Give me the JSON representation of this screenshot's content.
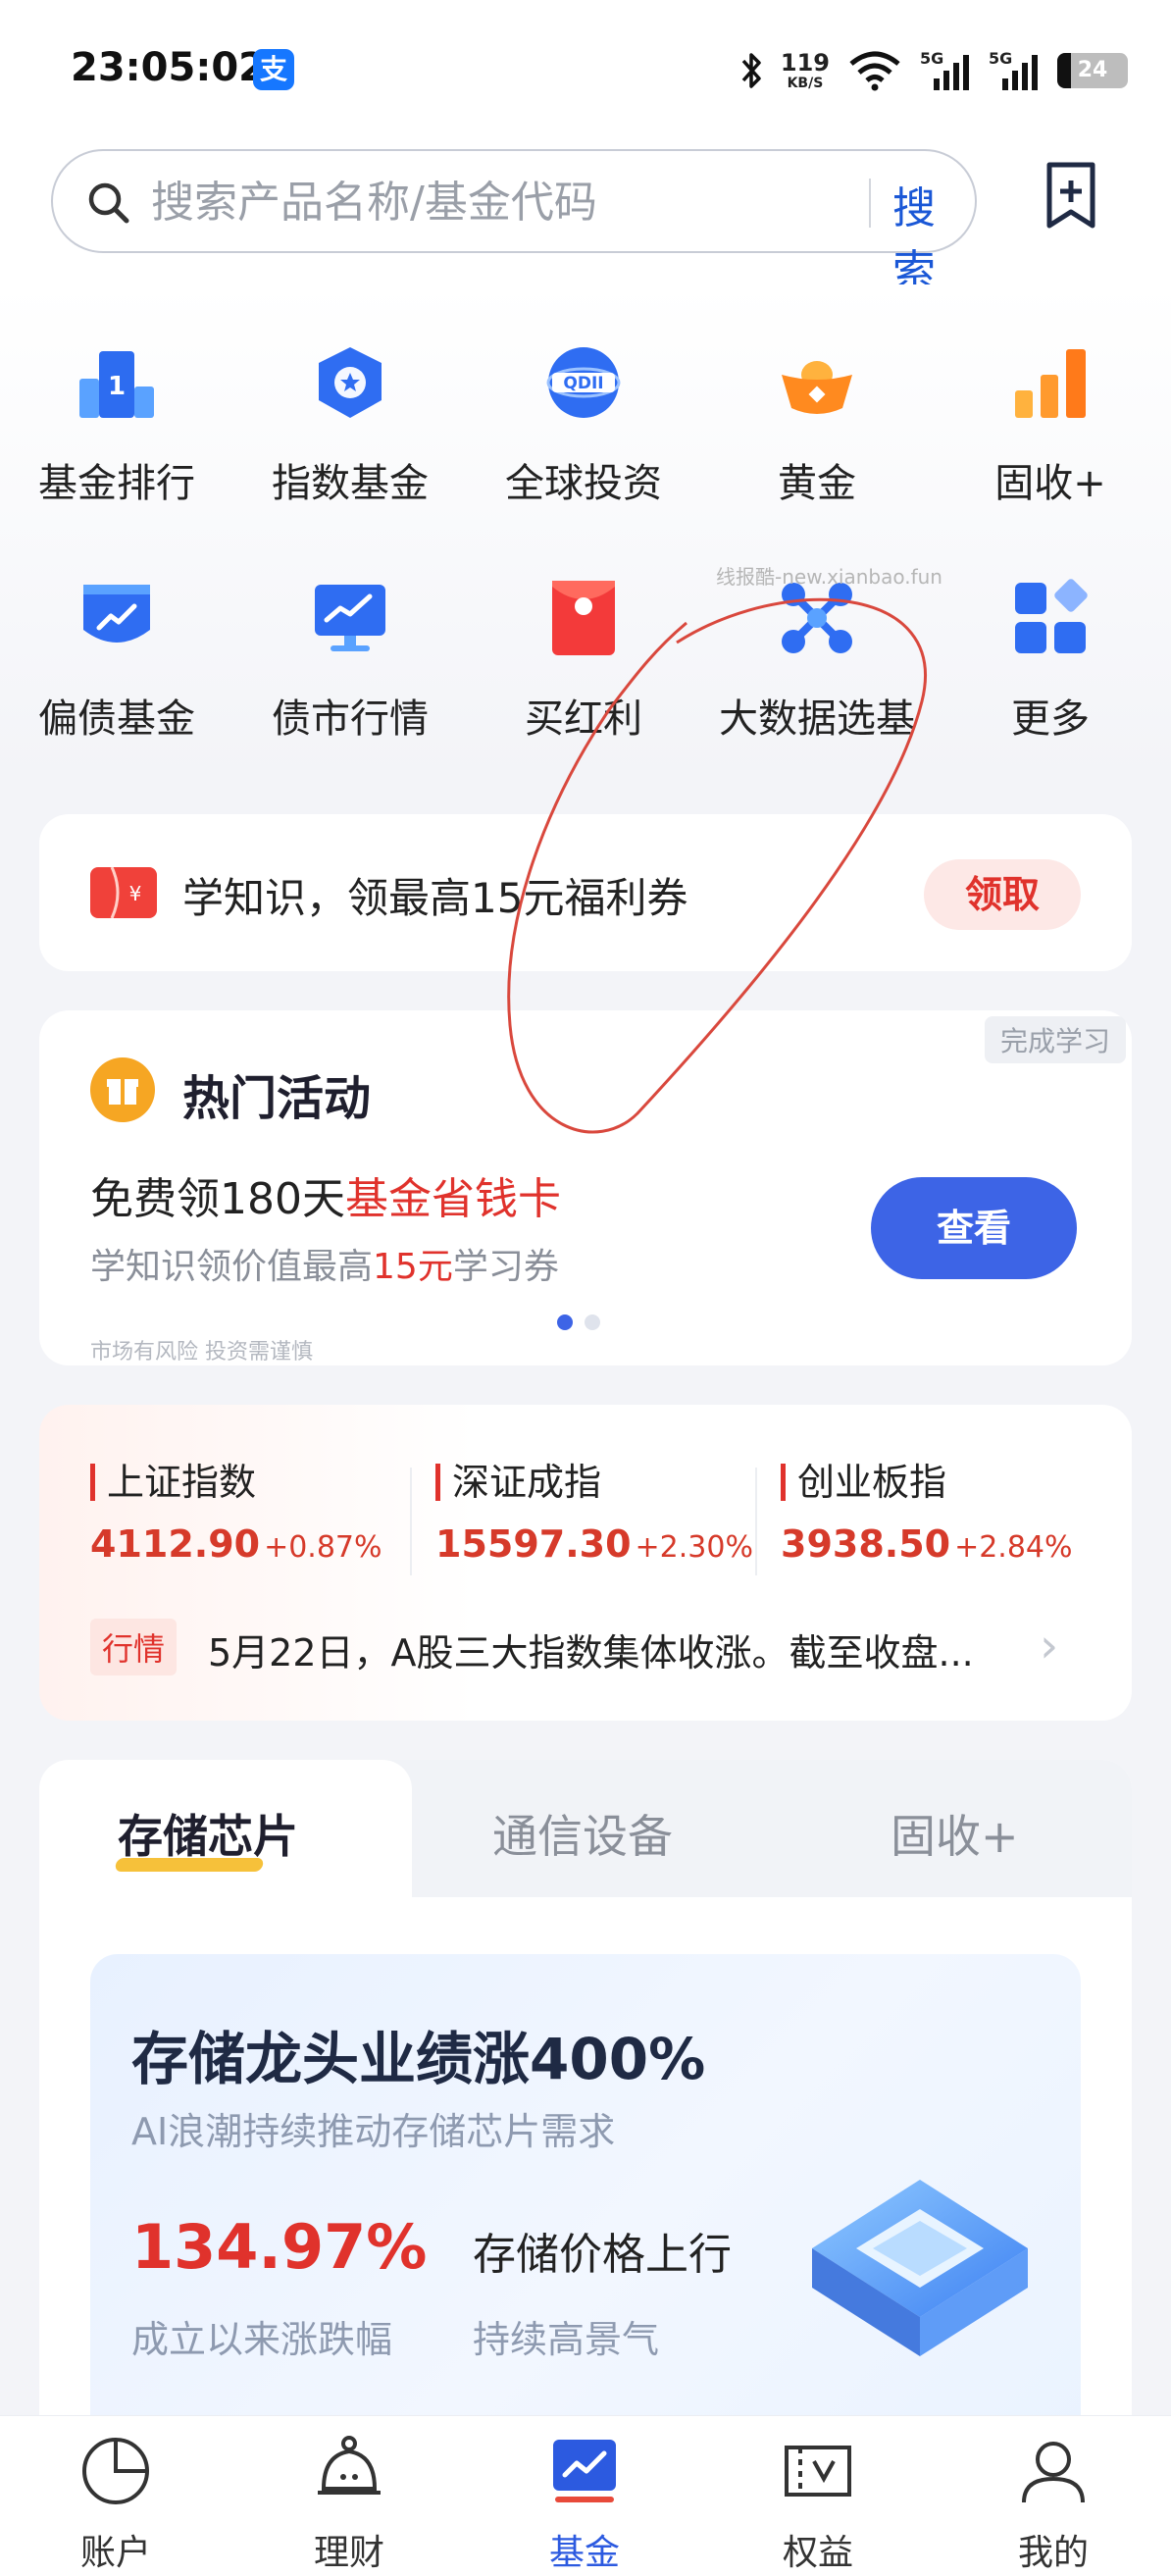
{
  "status_bar": {
    "time": "23:05:02",
    "app_badge": "支",
    "net_speed_value": "119",
    "net_speed_unit": "KB/S",
    "signal_label": "5G",
    "battery": "24"
  },
  "search": {
    "placeholder": "搜索产品名称/基金代码",
    "button": "搜索"
  },
  "grid": [
    {
      "label": "基金排行",
      "icon": "fund-ranking-icon"
    },
    {
      "label": "指数基金",
      "icon": "index-fund-icon"
    },
    {
      "label": "全球投资",
      "icon": "qdii-icon",
      "icon_text": "QDII"
    },
    {
      "label": "黄金",
      "icon": "gold-ingot-icon"
    },
    {
      "label": "固收+",
      "icon": "fixed-income-icon"
    },
    {
      "label": "偏债基金",
      "icon": "bond-fund-icon"
    },
    {
      "label": "债市行情",
      "icon": "bond-market-icon"
    },
    {
      "label": "买红利",
      "icon": "dividend-icon"
    },
    {
      "label": "大数据选基",
      "icon": "big-data-icon"
    },
    {
      "label": "更多",
      "icon": "more-icon"
    }
  ],
  "watermark": "线报酷-new.xianbao.fun",
  "promo": {
    "text": "学知识，领最高15元福利券",
    "button": "领取"
  },
  "hot_activity": {
    "corner_tag": "完成学习",
    "title": "热门活动",
    "line1_prefix": "免费领180天",
    "line1_highlight": "基金省钱卡",
    "line2_prefix": "学知识领价值最高",
    "line2_highlight": "15元",
    "line2_suffix": "学习券",
    "button": "查看",
    "risk_note": "市场有风险 投资需谨慎"
  },
  "indices": [
    {
      "name": "上证指数",
      "value": "4112.90",
      "change": "+0.87%"
    },
    {
      "name": "深证成指",
      "value": "15597.30",
      "change": "+2.30%"
    },
    {
      "name": "创业板指",
      "value": "3938.50",
      "change": "+2.84%"
    }
  ],
  "market_news": {
    "tag": "行情",
    "text": "5月22日，A股三大指数集体收涨。截至收盘..."
  },
  "sector_tabs": [
    "存储芯片",
    "通信设备",
    "固收+"
  ],
  "feature": {
    "headline": "存储龙头业绩涨400%",
    "subtitle": "AI浪潮持续推动存储芯片需求",
    "percent": "134.97%",
    "percent_label": "成立以来涨跌幅",
    "tag1": "存储价格上行",
    "tag2": "持续高景气"
  },
  "bottom_nav": [
    {
      "label": "账户",
      "icon": "account-pie-icon"
    },
    {
      "label": "理财",
      "icon": "wealth-bell-icon"
    },
    {
      "label": "基金",
      "icon": "fund-chart-icon",
      "active": true
    },
    {
      "label": "权益",
      "icon": "benefits-ticket-icon"
    },
    {
      "label": "我的",
      "icon": "profile-icon"
    }
  ],
  "colors": {
    "accent_blue": "#3d64e6",
    "rise_red": "#d63a2a",
    "nav_active": "#2c5ae0"
  }
}
